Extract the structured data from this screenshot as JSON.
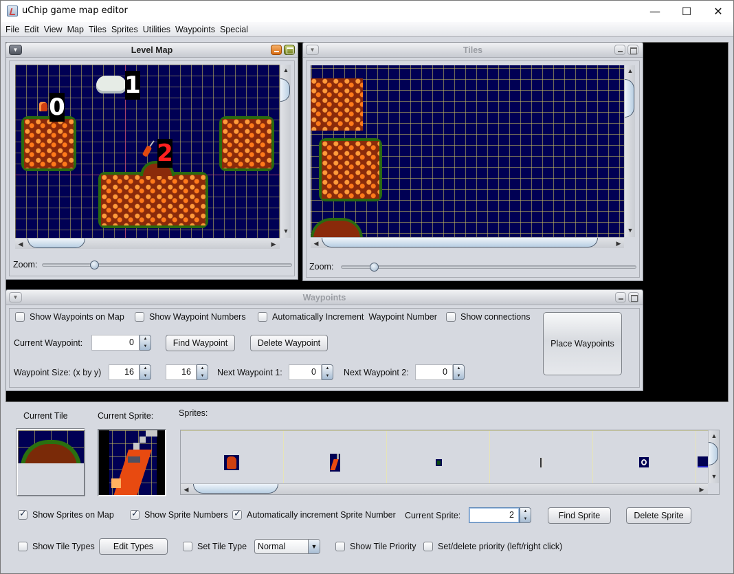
{
  "window": {
    "title": "uChip game map editor",
    "controls": {
      "minimize": "—",
      "maximize": "☐",
      "close": "✕"
    }
  },
  "menubar": [
    "File",
    "Edit",
    "View",
    "Map",
    "Tiles",
    "Sprites",
    "Utilities",
    "Waypoints",
    "Special"
  ],
  "level_map": {
    "title": "Level Map",
    "sprite_numbers": [
      "0",
      "1",
      "2"
    ],
    "sprite_number_colors": [
      "#ffffff",
      "#ffffff",
      "#ff2020"
    ],
    "zoom_label": "Zoom:",
    "zoom_fraction": 0.2
  },
  "tiles": {
    "title": "Tiles",
    "zoom_label": "Zoom:",
    "zoom_fraction": 0.1
  },
  "waypoints": {
    "title": "Waypoints",
    "show_on_map": {
      "label": "Show Waypoints on Map",
      "checked": false
    },
    "show_numbers": {
      "label": "Show Waypoint Numbers",
      "checked": false
    },
    "auto_increment": {
      "label": "Automatically Increment  Waypoint Number",
      "checked": false
    },
    "show_connections": {
      "label": "Show connections",
      "checked": false
    },
    "current_label": "Current Waypoint:",
    "current_value": "0",
    "find_button": "Find Waypoint",
    "delete_button": "Delete Waypoint",
    "size_label": "Waypoint Size: (x by y)",
    "size_x": "16",
    "size_y": "16",
    "next1_label": "Next Waypoint 1:",
    "next1_value": "0",
    "next2_label": "Next Waypoint 2:",
    "next2_value": "0",
    "place_button": "Place Waypoints"
  },
  "bottom": {
    "current_tile_label": "Current Tile",
    "current_sprite_label": "Current Sprite:",
    "sprites_label": "Sprites:",
    "sprite_list": [
      "player-sprite",
      "bomb-sprite",
      "green-gem-sprite",
      "switch-sprite",
      "target-sprite",
      "block-sprite"
    ],
    "show_sprites": {
      "label": "Show Sprites on Map",
      "checked": true
    },
    "show_sprite_numbers": {
      "label": "Show Sprite Numbers",
      "checked": true
    },
    "auto_increment_sprite": {
      "label": "Automatically increment Sprite Number",
      "checked": true
    },
    "current_sprite_label2": "Current Sprite:",
    "current_sprite_value": "2",
    "find_sprite": "Find Sprite",
    "delete_sprite": "Delete Sprite",
    "show_tile_types": {
      "label": "Show Tile Types",
      "checked": false
    },
    "edit_types": "Edit Types",
    "set_tile_type": {
      "label": "Set Tile Type",
      "checked": false
    },
    "tile_type_selected": "Normal",
    "show_tile_priority": {
      "label": "Show Tile Priority",
      "checked": false
    },
    "set_delete_priority": {
      "label": "Set/delete priority (left/right click)",
      "checked": false
    }
  }
}
